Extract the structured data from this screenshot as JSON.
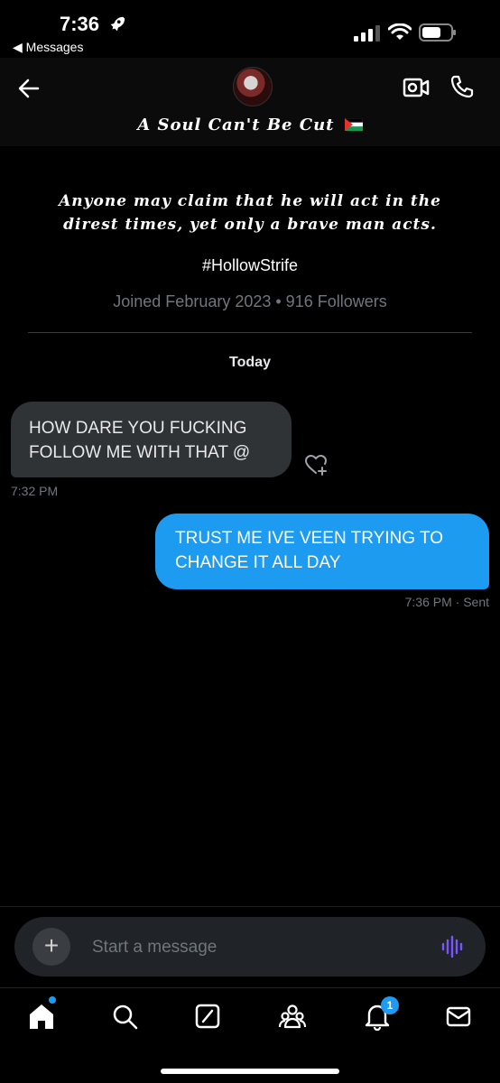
{
  "status_bar": {
    "time": "7:36",
    "back_app": "◀ Messages"
  },
  "header": {
    "name": "A Soul Can't Be Cut",
    "flag_icon": "palestine-flag-icon"
  },
  "profile": {
    "bio_line1": "Anyone may claim that he will act in the",
    "bio_line2": "direst times, yet only a brave man acts.",
    "hashtag": "#HollowStrife",
    "joined": "Joined February 2023 • 916 Followers"
  },
  "conversation": {
    "date_label": "Today",
    "messages": [
      {
        "direction": "incoming",
        "line1": "HOW DARE YOU FUCKING",
        "line2": "FOLLOW ME WITH THAT @",
        "time": "7:32 PM"
      },
      {
        "direction": "outgoing",
        "line1": "TRUST ME IVE VEEN TRYING TO",
        "line2": "CHANGE IT ALL DAY",
        "time": "7:36 PM",
        "status": "Sent",
        "time_status": "7:36 PM · Sent"
      }
    ]
  },
  "composer": {
    "placeholder": "Start a message"
  },
  "tab_bar": {
    "tabs": [
      "home-icon",
      "search-icon",
      "grok-icon",
      "communities-icon",
      "notifications-icon",
      "messages-icon"
    ],
    "notification_count": "1"
  },
  "colors": {
    "accent": "#1d9bf0",
    "incoming_bubble": "#2f3336",
    "voice": "#7856ff"
  }
}
